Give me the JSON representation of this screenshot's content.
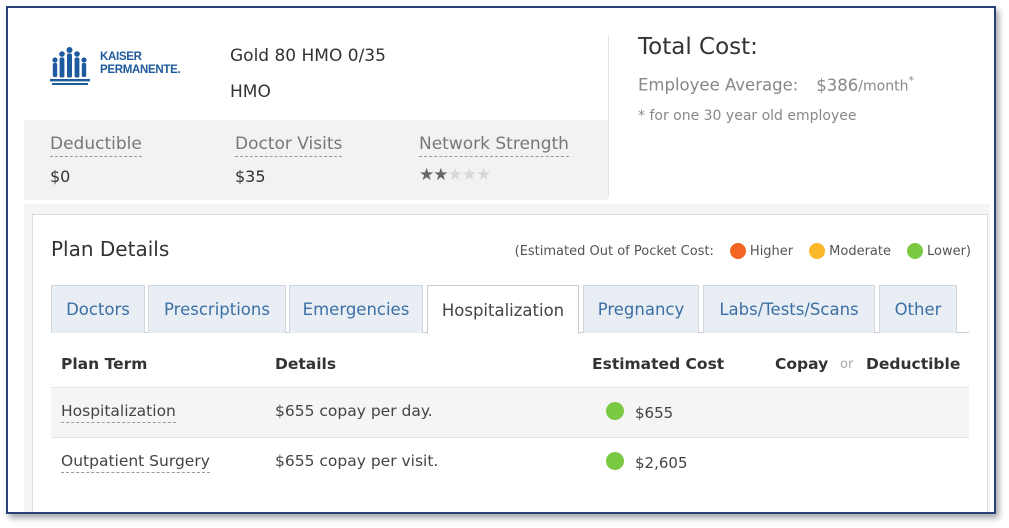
{
  "plan": {
    "carrier_logo_text": "KAISER PERMANENTE",
    "logo_line1": "KAISER",
    "logo_line2": "PERMANENTE.",
    "name": "Gold 80 HMO 0/35",
    "type": "HMO"
  },
  "stats": {
    "deductible_label": "Deductible",
    "deductible_value": "$0",
    "doctor_visits_label": "Doctor Visits",
    "doctor_visits_value": "$35",
    "network_strength_label": "Network Strength",
    "network_strength_rating": 2,
    "network_strength_max": 5
  },
  "cost": {
    "title": "Total Cost:",
    "employee_avg_label": "Employee Average:",
    "employee_avg_amount": "$386",
    "employee_avg_period": "/month",
    "asterisk": "*",
    "note": "* for one 30 year old employee"
  },
  "details": {
    "title": "Plan Details",
    "legend_prefix": "(Estimated Out of Pocket Cost:",
    "legend_higher": "Higher",
    "legend_moderate": "Moderate",
    "legend_lower": "Lower)",
    "colors": {
      "higher": "#f26522",
      "moderate": "#fbb829",
      "lower": "#7ac943"
    }
  },
  "tabs": [
    {
      "label": "Doctors"
    },
    {
      "label": "Prescriptions"
    },
    {
      "label": "Emergencies"
    },
    {
      "label": "Hospitalization",
      "active": true
    },
    {
      "label": "Pregnancy"
    },
    {
      "label": "Labs/Tests/Scans"
    },
    {
      "label": "Other"
    }
  ],
  "table": {
    "col_plan_term": "Plan Term",
    "col_details": "Details",
    "col_estimated_cost": "Estimated Cost",
    "col_copay": "Copay",
    "col_or": "or",
    "col_deductible": "Deductible",
    "rows": [
      {
        "term": "Hospitalization",
        "details": "$655 copay per day.",
        "cost_level": "lower",
        "cost": "$655"
      },
      {
        "term": "Outpatient Surgery",
        "details": "$655 copay per visit.",
        "cost_level": "lower",
        "cost": "$2,605"
      }
    ]
  }
}
